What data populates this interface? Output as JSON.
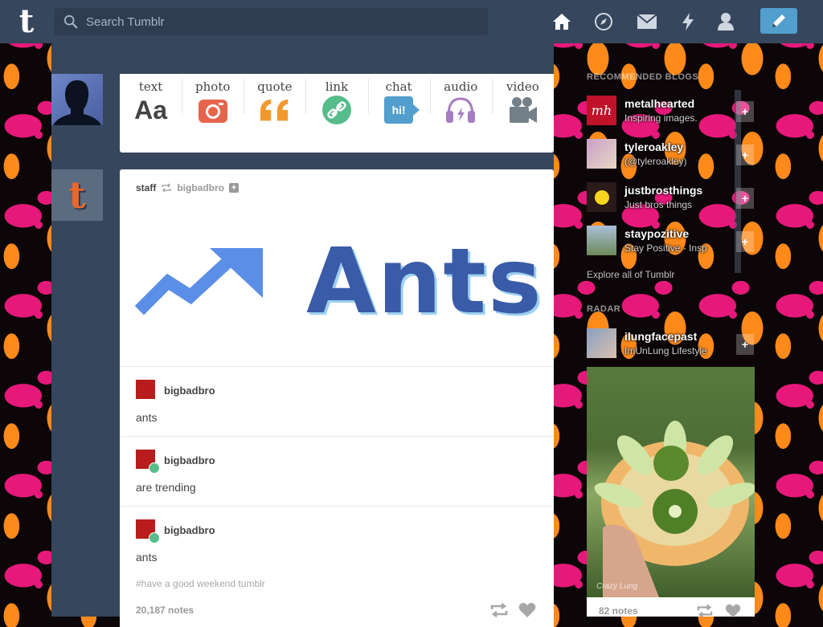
{
  "topbar": {
    "logo_text": "t",
    "search_placeholder": "Search Tumblr",
    "nav_icons": [
      "home-icon",
      "compass-icon",
      "mail-icon",
      "lightning-icon",
      "account-icon"
    ],
    "compose_icon": "pencil-icon"
  },
  "post_form": {
    "items": [
      {
        "label": "text",
        "icon_text": "Aa"
      },
      {
        "label": "photo",
        "icon": "camera-icon"
      },
      {
        "label": "quote",
        "icon_text": "“"
      },
      {
        "label": "link",
        "icon": "link-icon"
      },
      {
        "label": "chat",
        "icon_text": "hi!"
      },
      {
        "label": "audio",
        "icon": "headphones-icon"
      },
      {
        "label": "video",
        "icon": "video-camera-icon"
      }
    ]
  },
  "post": {
    "author": "staff",
    "reblogged_from": "bigbadbro",
    "banner_text": "Ants",
    "reblogs": [
      {
        "user": "bigbadbro",
        "text": "ants"
      },
      {
        "user": "bigbadbro",
        "text": "are trending"
      },
      {
        "user": "bigbadbro",
        "text": "ants"
      }
    ],
    "tags": "#have a good weekend tumblr",
    "notes": "20,187 notes"
  },
  "sidebar": {
    "recommended_heading": "RECOMMENDED BLOGS",
    "blogs": [
      {
        "name": "metalhearted",
        "desc": "Inspiring images.",
        "follow": "+"
      },
      {
        "name": "tyleroakley",
        "desc": "(@tyleroakley)",
        "follow": "+"
      },
      {
        "name": "justbrosthings",
        "desc": "Just bros things",
        "follow": "+"
      },
      {
        "name": "staypozitive",
        "desc": "Stay Positive - Insp",
        "follow": "+"
      }
    ],
    "explore_link": "Explore all of Tumblr",
    "radar_heading": "RADAR",
    "radar_blog": {
      "name": "ilungfacepast",
      "desc": "ImUnLung Lifestyle",
      "follow": "+"
    },
    "radar_image_credit": "Crazy Lung",
    "radar_notes": "82 notes"
  },
  "colors": {
    "topbar": "#36465d",
    "accent": "#529ecc",
    "background_pink": "#e6197a",
    "background_orange": "#ff8a1a"
  }
}
